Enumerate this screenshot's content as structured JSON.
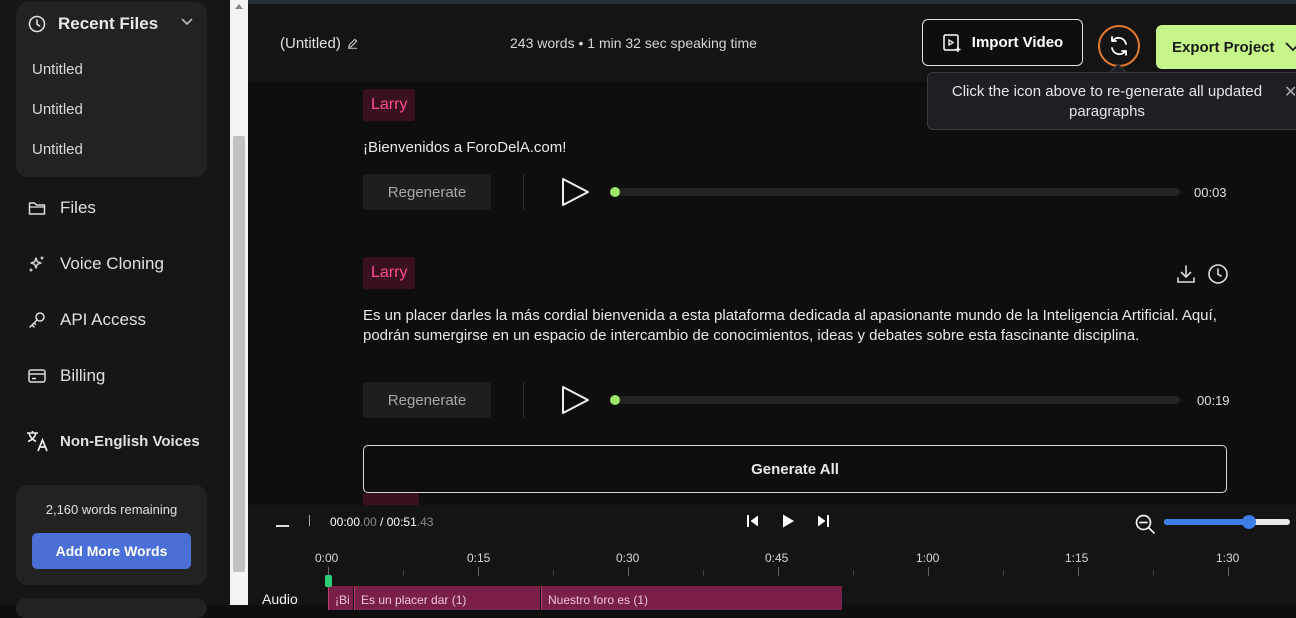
{
  "sidebar": {
    "recent_files_title": "Recent Files",
    "recent_files": [
      "Untitled",
      "Untitled",
      "Untitled"
    ],
    "nav": [
      {
        "label": "Files",
        "icon": "folder-icon"
      },
      {
        "label": "Voice Cloning",
        "icon": "sparkle-icon"
      },
      {
        "label": "API Access",
        "icon": "key-icon"
      },
      {
        "label": "Billing",
        "icon": "card-icon"
      }
    ],
    "non_english_label": "Non-English Voices",
    "words_remaining": "2,160 words remaining",
    "add_words_label": "Add More Words"
  },
  "header": {
    "project_title": "(Untitled)",
    "stats": "243 words • 1 min 32 sec speaking time",
    "import_label": "Import Video",
    "export_label": "Export Project",
    "tooltip": "Click the icon above to re-generate all updated paragraphs"
  },
  "paragraphs": [
    {
      "speaker": "Larry",
      "text": "¡Bienvenidos a ForoDelA.com!",
      "regen_label": "Regenerate",
      "duration": "00:03"
    },
    {
      "speaker": "Larry",
      "text": "Es un placer darles la más cordial bienvenida a esta plataforma dedicada al apasionante mundo de la Inteligencia Artificial. Aquí, podrán sumergirse en un espacio de intercambio de conocimientos, ideas y debates sobre esta fascinante disciplina.",
      "regen_label": "Regenerate",
      "duration": "00:19"
    }
  ],
  "generate_all_label": "Generate All",
  "timeline": {
    "current": "00:00",
    "current_ms": ".00",
    "separator": " / ",
    "total": "00:51",
    "total_ms": ".43",
    "ticks": [
      "0:00",
      "0:15",
      "0:30",
      "0:45",
      "1:00",
      "1:15",
      "1:30"
    ],
    "track_label": "Audio",
    "clips": [
      "¡Bi",
      "Es un placer dar (1)",
      "Nuestro foro es (1)"
    ],
    "zoom_level": 0.7
  },
  "colors": {
    "speaker": "#ff4d8d",
    "export": "#c6f58a",
    "accent_blue": "#4a6fd6",
    "progress_dot": "#9be86b",
    "regen_ring": "#e07a2f"
  }
}
